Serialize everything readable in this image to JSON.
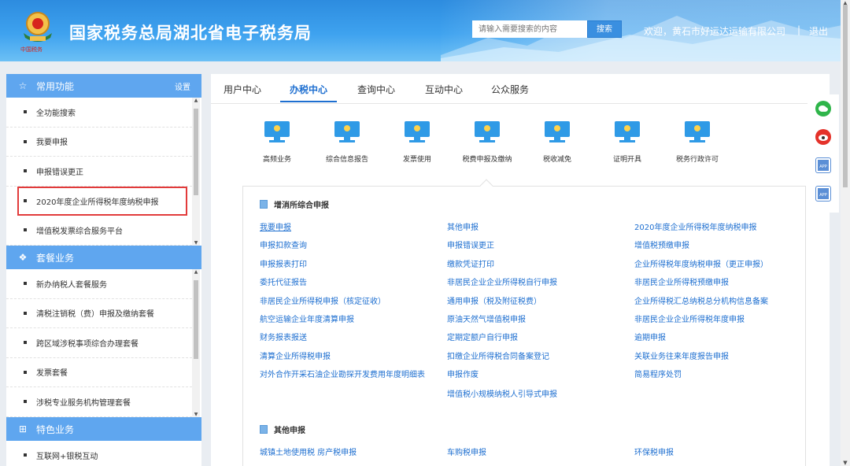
{
  "header": {
    "emblem_caption": "中国税务",
    "title": "国家税务总局湖北省电子税务局",
    "search_placeholder": "请输入需要搜索的内容",
    "search_button": "搜索",
    "welcome": "欢迎，黄石市好运达运输有限公司",
    "separator": "|",
    "logout": "退出"
  },
  "sidebar": {
    "sections": [
      {
        "title": "常用功能",
        "icon": "star-icon",
        "action": "设置",
        "items": [
          "全功能搜索",
          "我要申报",
          "申报错误更正",
          "2020年度企业所得税年度纳税申报",
          "增值税发票综合服务平台"
        ]
      },
      {
        "title": "套餐业务",
        "icon": "stack-icon",
        "items": [
          "新办纳税人套餐服务",
          "清税注销税（费）申报及缴纳套餐",
          "跨区域涉税事项综合办理套餐",
          "发票套餐",
          "涉税专业服务机构管理套餐"
        ]
      },
      {
        "title": "特色业务",
        "icon": "grid-icon",
        "items": [
          "互联网+银税互动"
        ]
      }
    ]
  },
  "main": {
    "tabs": [
      "用户中心",
      "办税中心",
      "查询中心",
      "互动中心",
      "公众服务"
    ],
    "active_tab": "办税中心",
    "categories": [
      "高频业务",
      "综合信息报告",
      "发票使用",
      "税费申报及缴纳",
      "税收减免",
      "证明开具",
      "税务行政许可"
    ],
    "groups": [
      {
        "title": "增消所综合申报",
        "links": [
          [
            "我要申报",
            "其他申报",
            "2020年度企业所得税年度纳税申报"
          ],
          [
            "申报扣款查询",
            "申报错误更正",
            "增值税预缴申报"
          ],
          [
            "申报报表打印",
            "缴款凭证打印",
            "企业所得税年度纳税申报（更正申报）"
          ],
          [
            "委托代征报告",
            "非居民企业企业所得税自行申报",
            "非居民企业所得税预缴申报"
          ],
          [
            "非居民企业所得税申报（核定征收）",
            "通用申报（税及附征税费）",
            "企业所得税汇总纳税总分机构信息备案"
          ],
          [
            "航空运输企业年度清算申报",
            "原油天然气增值税申报",
            "非居民企业企业所得税年度申报"
          ],
          [
            "财务报表报送",
            "定期定额户自行申报",
            "逾期申报"
          ],
          [
            "清算企业所得税申报",
            "扣缴企业所得税合同备案登记",
            "关联业务往来年度报告申报"
          ],
          [
            "对外合作开采石油企业勘探开发费用年度明细表",
            "申报作废",
            "简易程序处罚"
          ],
          [
            "",
            "增值税小规模纳税人引导式申报",
            ""
          ]
        ]
      },
      {
        "title": "其他申报",
        "links": [
          [
            "城镇土地使用税 房产税申报",
            "车购税申报",
            "环保税申报"
          ]
        ]
      }
    ]
  },
  "float": {
    "icons": [
      "wechat-icon",
      "weibo-icon",
      "app-icon",
      "app-icon"
    ],
    "app_label": "APP"
  },
  "colors": {
    "header": "#3ea2ef",
    "sidebar_head": "#5fa6ef",
    "link": "#1e6fd0",
    "highlight": "#e23b3b"
  }
}
